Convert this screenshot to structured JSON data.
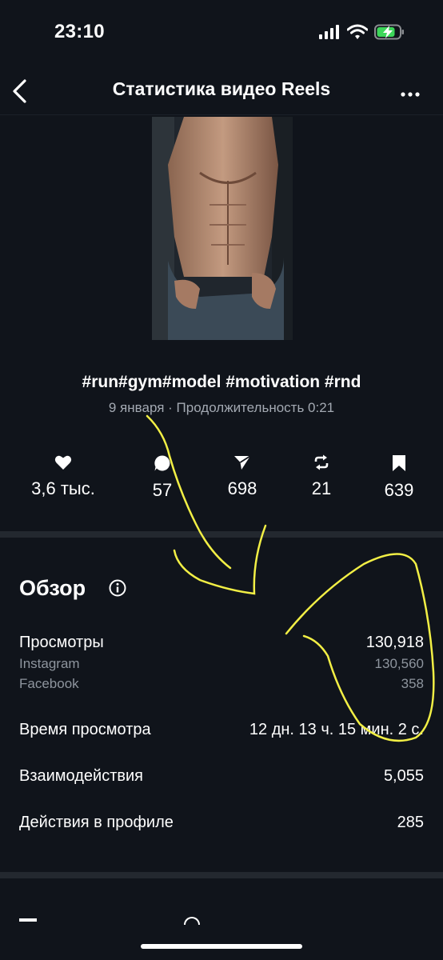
{
  "status_bar": {
    "time": "23:10",
    "icons": [
      "signal-icon",
      "wifi-icon",
      "battery-charging-icon"
    ]
  },
  "header": {
    "title": "Статистика видео Reels",
    "back_icon": "chevron-left-icon",
    "more_icon": "more-horizontal-icon"
  },
  "video": {
    "caption": "#run#gym#model #motivation #rnd",
    "meta": "9 января · Продолжительность 0:21"
  },
  "engagement": [
    {
      "icon": "heart-icon",
      "value": "3,6 тыс."
    },
    {
      "icon": "comment-icon",
      "value": "57"
    },
    {
      "icon": "send-icon",
      "value": "698"
    },
    {
      "icon": "repost-icon",
      "value": "21"
    },
    {
      "icon": "bookmark-icon",
      "value": "639"
    }
  ],
  "overview": {
    "title": "Обзор",
    "views": {
      "label": "Просмотры",
      "value": "130,918",
      "breakdown": [
        {
          "label": "Instagram",
          "value": "130,560"
        },
        {
          "label": "Facebook",
          "value": "358"
        }
      ]
    },
    "watch_time": {
      "label": "Время просмотра",
      "value": "12 дн. 13 ч. 15 мин. 2 с."
    },
    "interactions": {
      "label": "Взаимодействия",
      "value": "5,055"
    },
    "profile_actions": {
      "label": "Действия в профиле",
      "value": "285"
    }
  },
  "colors": {
    "background": "#10141b",
    "text": "#ffffff",
    "muted": "#a3a9b2",
    "divider": "#23282f",
    "annotation": "#f2ef45"
  }
}
